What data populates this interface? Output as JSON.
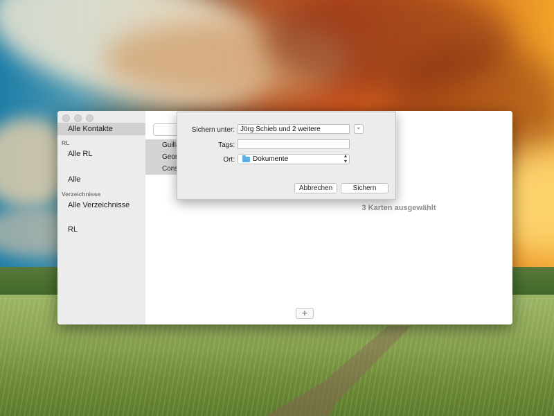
{
  "sidebar": {
    "items": [
      {
        "label": "Alle Kontakte",
        "selected": true
      },
      {
        "label": "Alle RL"
      },
      {
        "label": "Alle"
      },
      {
        "label": "Alle Verzeichnisse"
      },
      {
        "label": "RL"
      }
    ],
    "headers": [
      "RL",
      "Verzeichnisse"
    ]
  },
  "contacts": [
    "Guilla",
    "Geor",
    "Cons"
  ],
  "detail": {
    "selected_text": "3 Karten ausgewählt",
    "add_label": "+"
  },
  "save_sheet": {
    "save_as_label": "Sichern unter:",
    "save_as_value": "Jörg Schieb und 2 weitere",
    "tags_label": "Tags:",
    "tags_value": "",
    "location_label": "Ort:",
    "location_value": "Dokumente",
    "cancel_label": "Abbrechen",
    "save_label": "Sichern",
    "icons": [
      "chevron-down-icon",
      "folder-icon",
      "updown-arrows-icon"
    ]
  },
  "colors": {
    "sidebar_bg": "#ececec",
    "selection": "#d0d0d0",
    "folder_blue": "#5cb0e6"
  }
}
